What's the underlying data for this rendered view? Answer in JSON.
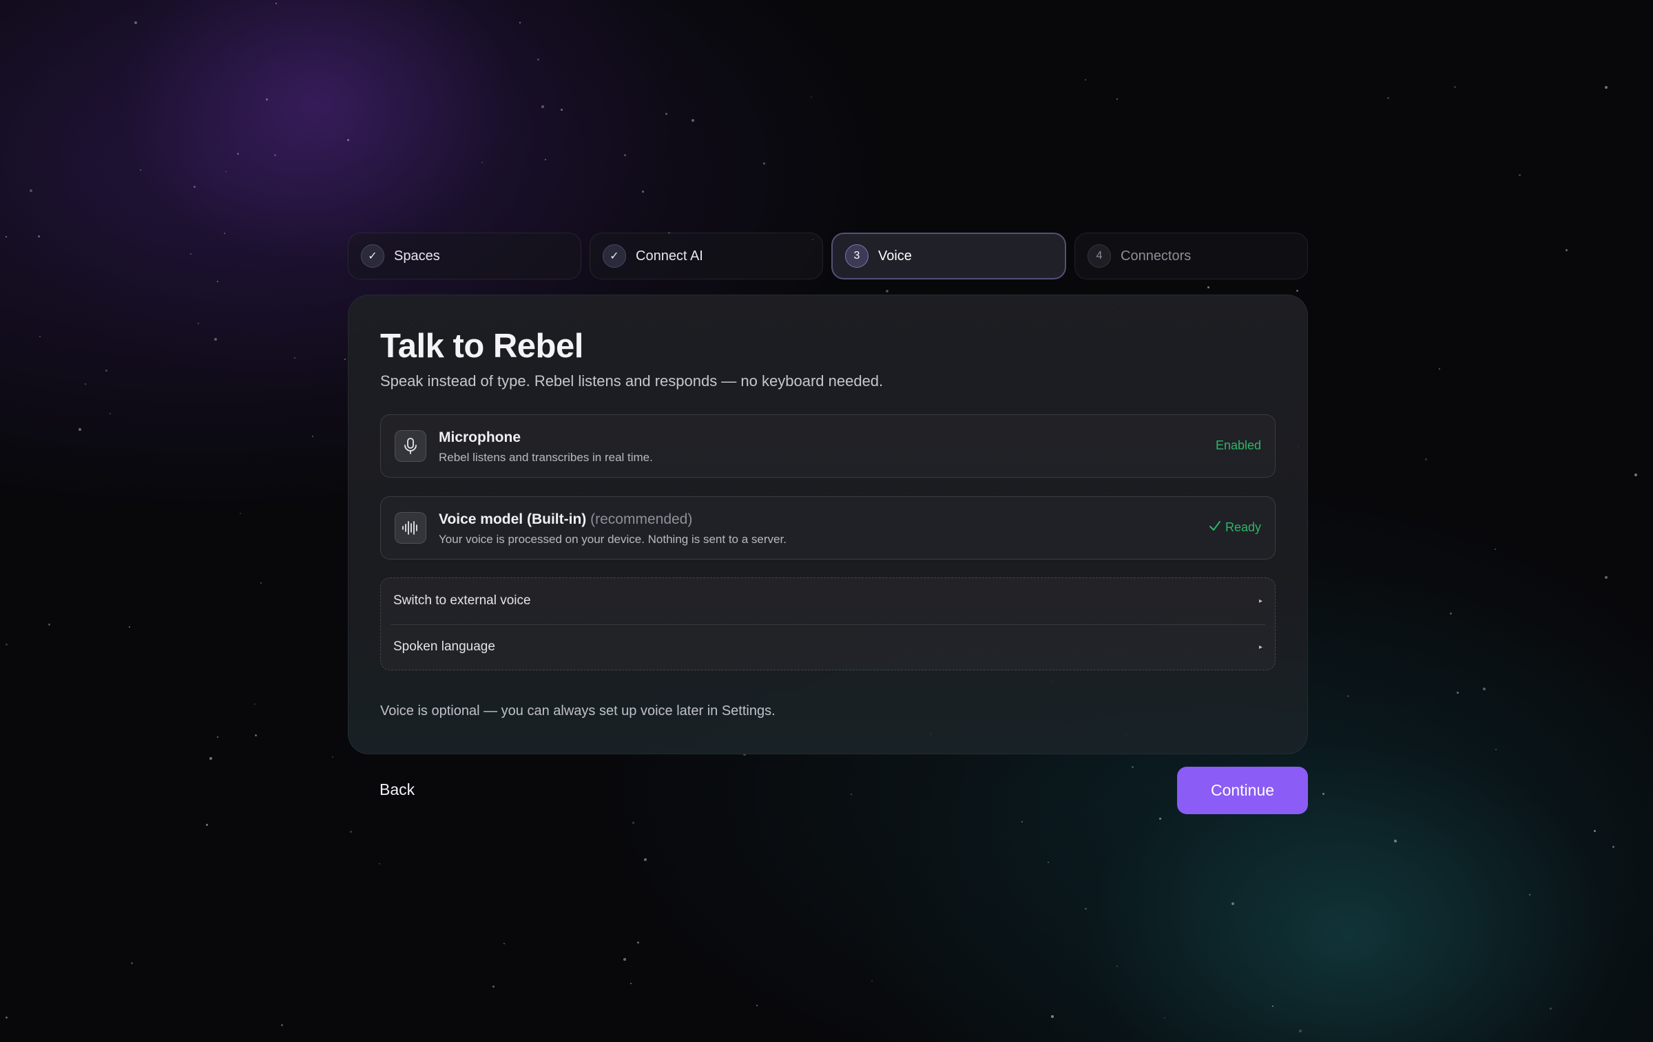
{
  "stepper": {
    "steps": [
      {
        "badge": "✓",
        "label": "Spaces",
        "state": "done"
      },
      {
        "badge": "✓",
        "label": "Connect AI",
        "state": "done"
      },
      {
        "badge": "3",
        "label": "Voice",
        "state": "active"
      },
      {
        "badge": "4",
        "label": "Connectors",
        "state": "pending"
      }
    ]
  },
  "card": {
    "title": "Talk to Rebel",
    "subtitle": "Speak instead of type. Rebel listens and responds — no keyboard needed.",
    "microphone": {
      "icon": "microphone-icon",
      "title": "Microphone",
      "description": "Rebel listens and transcribes in real time.",
      "status": "Enabled"
    },
    "voice_model": {
      "icon": "waveform-icon",
      "title": "Voice model (Built-in)",
      "tag": "(recommended)",
      "description": "Your voice is processed on your device. Nothing is sent to a server.",
      "status_icon": "check-icon",
      "status": "Ready"
    },
    "options": [
      {
        "label": "Switch to external voice",
        "icon": "caret-right-icon"
      },
      {
        "label": "Spoken language",
        "icon": "caret-right-icon"
      }
    ],
    "footnote": "Voice is optional — you can always set up voice later in Settings."
  },
  "actions": {
    "back_label": "Back",
    "continue_label": "Continue"
  },
  "colors": {
    "accent": "#8b5cf6",
    "success": "#2fb56a"
  }
}
